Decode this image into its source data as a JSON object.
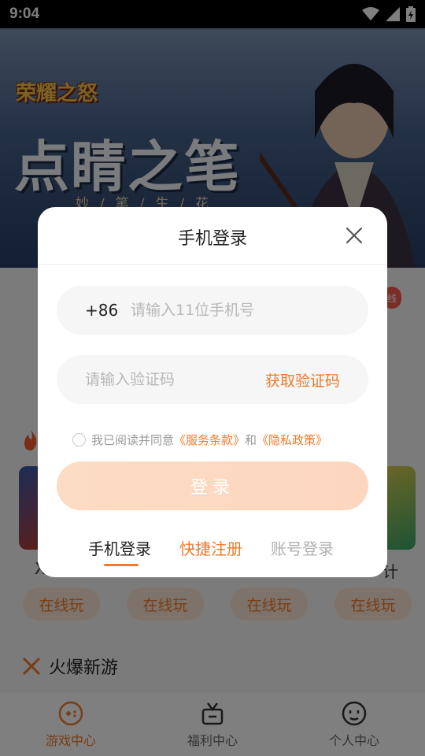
{
  "status_bar": {
    "time": "9:04"
  },
  "banner": {
    "logo_text": "荣耀之怒",
    "title": "点睛之笔",
    "subtitle": "妙/笔/生/花"
  },
  "background": {
    "hot_header_text": "",
    "play_buttons": [
      "在线玩",
      "在线玩",
      "在线玩",
      "在线玩"
    ],
    "section_title": "火爆新游",
    "side_left": "X",
    "side_right": "计",
    "side_badge": "线"
  },
  "bottom_nav": {
    "items": [
      {
        "label": "游戏中心",
        "active": true
      },
      {
        "label": "福利中心",
        "active": false
      },
      {
        "label": "个人中心",
        "active": false
      }
    ]
  },
  "dialog": {
    "title": "手机登录",
    "country_code": "+86",
    "phone_placeholder": "请输入11位手机号",
    "code_placeholder": "请输入验证码",
    "get_code_label": "获取验证码",
    "agreement_prefix": "我已阅读并同意",
    "terms_link": "《服务条款》",
    "agreement_and": "和",
    "privacy_link": "《隐私政策》",
    "login_button": "登录",
    "tabs": [
      {
        "label": "手机登录",
        "state": "active"
      },
      {
        "label": "快捷注册",
        "state": "accent"
      },
      {
        "label": "账号登录",
        "state": "inactive"
      }
    ]
  },
  "colors": {
    "accent": "#f07a2a",
    "login_button": "#fdd6bf",
    "overlay": "rgba(0,0,0,0.5)"
  }
}
